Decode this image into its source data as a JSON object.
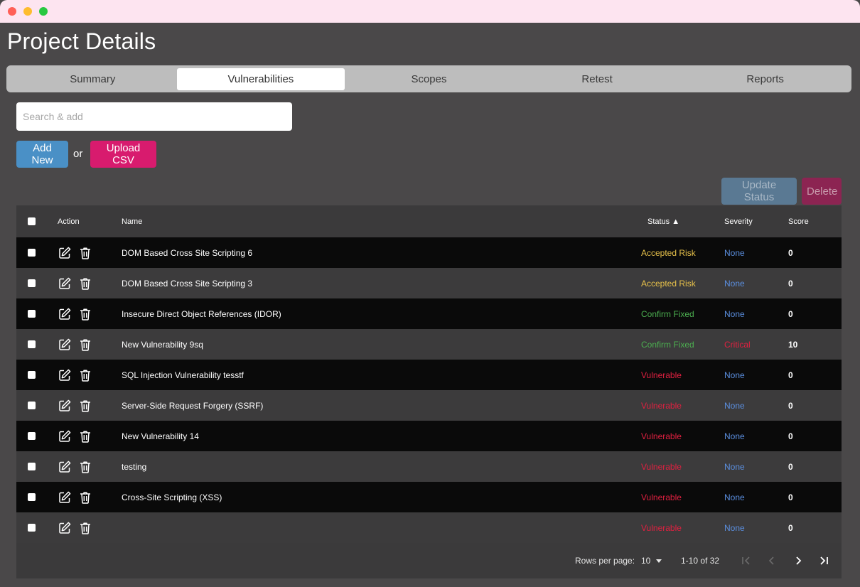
{
  "page": {
    "title": "Project Details"
  },
  "tabs": [
    {
      "label": "Summary",
      "active": false
    },
    {
      "label": "Vulnerabilities",
      "active": true
    },
    {
      "label": "Scopes",
      "active": false
    },
    {
      "label": "Retest",
      "active": false
    },
    {
      "label": "Reports",
      "active": false
    }
  ],
  "search": {
    "placeholder": "Search & add",
    "value": ""
  },
  "toolbar": {
    "add_new_label": "Add New",
    "or_label": "or",
    "upload_csv_label": "Upload CSV",
    "update_status_label": "Update Status",
    "delete_label": "Delete"
  },
  "table": {
    "columns": {
      "action": "Action",
      "name": "Name",
      "status": "Status ▲",
      "severity": "Severity",
      "score": "Score"
    },
    "rows": [
      {
        "name": "DOM Based Cross Site Scripting 6",
        "status": "Accepted Risk",
        "severity": "None",
        "score": "0"
      },
      {
        "name": "DOM Based Cross Site Scripting 3",
        "status": "Accepted Risk",
        "severity": "None",
        "score": "0"
      },
      {
        "name": "Insecure Direct Object References (IDOR)",
        "status": "Confirm Fixed",
        "severity": "None",
        "score": "0"
      },
      {
        "name": "New Vulnerability 9sq",
        "status": "Confirm Fixed",
        "severity": "Critical",
        "score": "10"
      },
      {
        "name": "SQL Injection Vulnerability tesstf",
        "status": "Vulnerable",
        "severity": "None",
        "score": "0"
      },
      {
        "name": "Server-Side Request Forgery (SSRF)",
        "status": "Vulnerable",
        "severity": "None",
        "score": "0"
      },
      {
        "name": "New Vulnerability 14",
        "status": "Vulnerable",
        "severity": "None",
        "score": "0"
      },
      {
        "name": "testing",
        "status": "Vulnerable",
        "severity": "None",
        "score": "0"
      },
      {
        "name": "Cross-Site Scripting (XSS)",
        "status": "Vulnerable",
        "severity": "None",
        "score": "0"
      },
      {
        "name": "",
        "status": "Vulnerable",
        "severity": "None",
        "score": "0"
      }
    ]
  },
  "pagination": {
    "rows_per_page_label": "Rows per page:",
    "rows_per_page_value": "10",
    "range_label": "1-10 of 32"
  },
  "icons": {
    "edit": "edit-icon",
    "delete": "trash-icon",
    "first": "first-page-icon",
    "prev": "chevron-left-icon",
    "next": "chevron-right-icon",
    "last": "last-page-icon"
  },
  "colors": {
    "accepted_risk": "#e7c14a",
    "confirm_fixed": "#4caf50",
    "vulnerable": "#e02040",
    "severity_none": "#5b8fe0",
    "severity_critical": "#e02040",
    "add_new": "#4a90c6",
    "upload_csv": "#d81b6e"
  }
}
